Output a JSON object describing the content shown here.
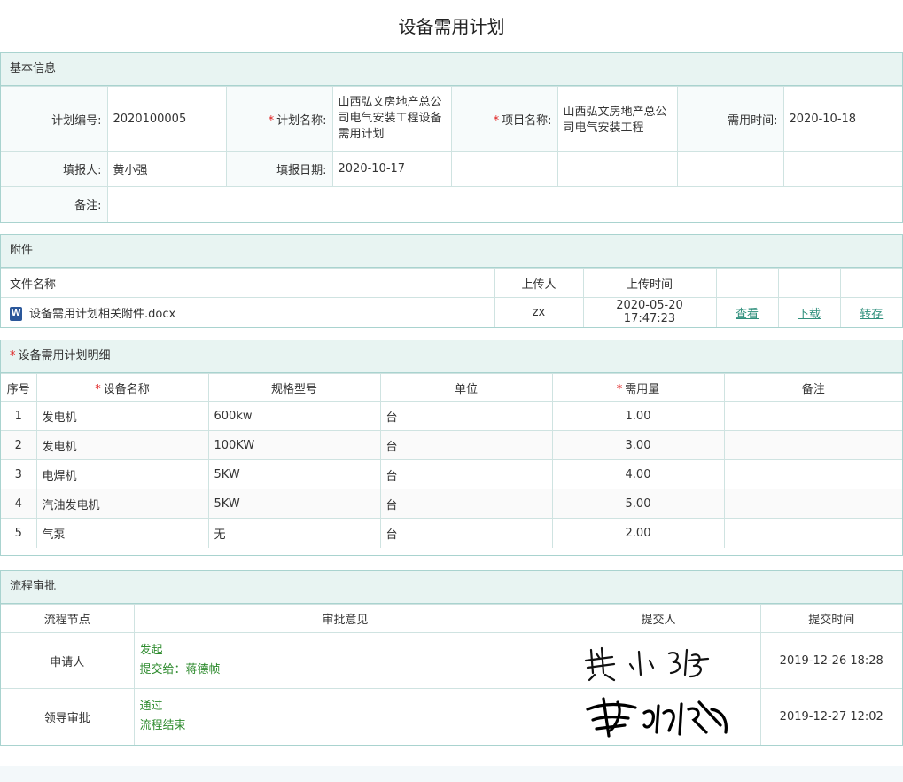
{
  "title": "设备需用计划",
  "basic": {
    "header": "基本信息",
    "plan_no_label": "计划编号:",
    "plan_no": "2020100005",
    "plan_name_label": "计划名称:",
    "plan_name": "山西弘文房地产总公司电气安装工程设备需用计划",
    "project_label": "项目名称:",
    "project": "山西弘文房地产总公司电气安装工程",
    "need_time_label": "需用时间:",
    "need_time": "2020-10-18",
    "reporter_label": "填报人:",
    "reporter": "黄小强",
    "report_date_label": "填报日期:",
    "report_date": "2020-10-17",
    "remark_label": "备注:",
    "remark": ""
  },
  "attachments": {
    "header": "附件",
    "columns": [
      "文件名称",
      "上传人",
      "上传时间"
    ],
    "rows": [
      {
        "name": "设备需用计划相关附件.docx",
        "uploader": "zx",
        "time": "2020-05-20 17:47:23",
        "view": "查看",
        "download": "下载",
        "transfer": "转存"
      }
    ]
  },
  "details": {
    "header": "设备需用计划明细",
    "columns": [
      "序号",
      "设备名称",
      "规格型号",
      "单位",
      "需用量",
      "备注"
    ],
    "rows": [
      {
        "no": "1",
        "name": "发电机",
        "spec": "600kw",
        "unit": "台",
        "qty": "1.00",
        "remark": ""
      },
      {
        "no": "2",
        "name": "发电机",
        "spec": "100KW",
        "unit": "台",
        "qty": "3.00",
        "remark": ""
      },
      {
        "no": "3",
        "name": "电焊机",
        "spec": "5KW",
        "unit": "台",
        "qty": "4.00",
        "remark": ""
      },
      {
        "no": "4",
        "name": "汽油发电机",
        "spec": "5KW",
        "unit": "台",
        "qty": "5.00",
        "remark": ""
      },
      {
        "no": "5",
        "name": "气泵",
        "spec": "无",
        "unit": "台",
        "qty": "2.00",
        "remark": ""
      }
    ]
  },
  "approval": {
    "header": "流程审批",
    "columns": [
      "流程节点",
      "审批意见",
      "提交人",
      "提交时间"
    ],
    "rows": [
      {
        "node": "申请人",
        "opinion1": "发起",
        "opinion2": "提交给：蒋德帧",
        "submitter_signature": "黄小强",
        "time": "2019-12-26 18:28"
      },
      {
        "node": "领导审批",
        "opinion1": "通过",
        "opinion2": "流程结束",
        "submitter_signature": "蒋德帧",
        "time": "2019-12-27 12:02"
      }
    ]
  }
}
